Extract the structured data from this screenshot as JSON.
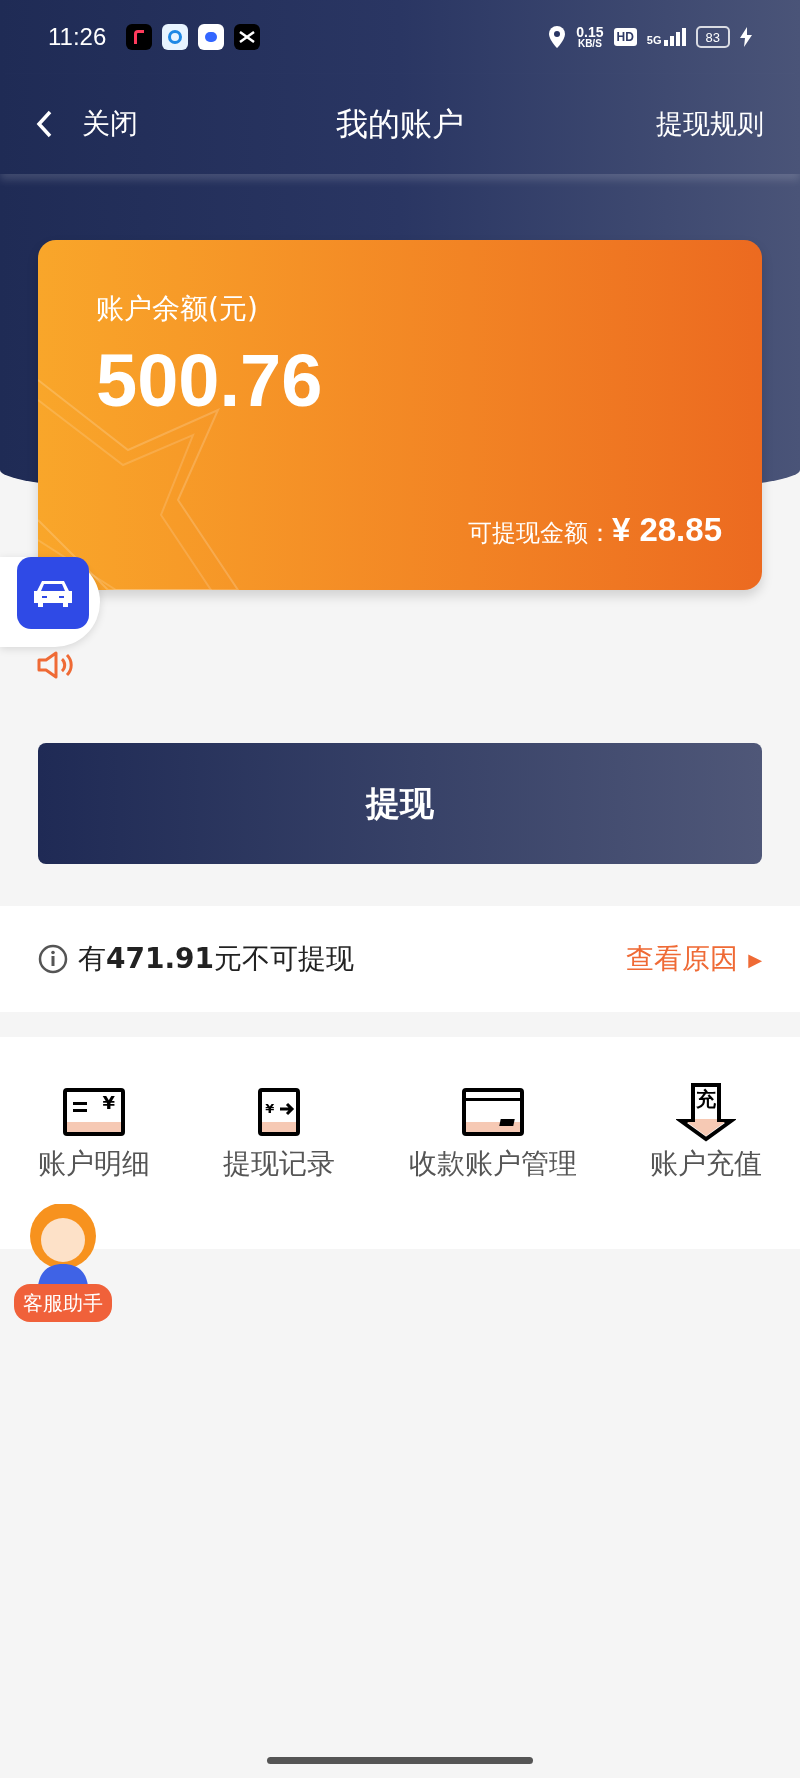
{
  "status_bar": {
    "time": "11:26",
    "net_speed": "0.15",
    "net_unit": "KB/S",
    "hd": "HD",
    "network": "5G",
    "battery": "83"
  },
  "nav": {
    "back": "关闭",
    "title": "我的账户",
    "action": "提现规则"
  },
  "balance_card": {
    "label": "账户余额(元)",
    "amount": "500.76",
    "withdrawable_label": "可提现金额：",
    "withdrawable_amount": "¥ 28.85"
  },
  "withdraw_button": "提现",
  "notice": {
    "prefix": "有",
    "amount": "471.91",
    "suffix": "元不可提现",
    "link": "查看原因",
    "arrow": "▶"
  },
  "menu": [
    {
      "kind": "ledger",
      "glyph": "¥",
      "label": "账户明细"
    },
    {
      "kind": "withdraw",
      "glyph": "¥",
      "label": "提现记录"
    },
    {
      "kind": "card",
      "label": "收款账户管理"
    },
    {
      "kind": "recharge",
      "glyph": "充",
      "label": "账户充值"
    }
  ],
  "assistant": {
    "label": "客服助手"
  }
}
